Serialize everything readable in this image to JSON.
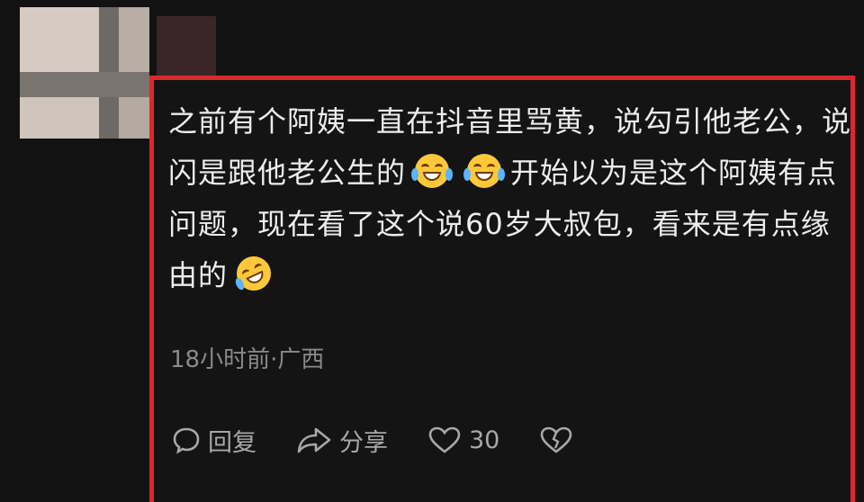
{
  "comment": {
    "text_part1": "之前有个阿姨一直在抖音里骂黄，说勾引他老公，说闪是跟他老公生的",
    "text_part2": "开始以为是这个阿姨有点问题，现在看了这个说60岁大叔包，看来是有点缘由的",
    "emoji_icons": [
      "laugh-cry-icon",
      "laugh-cry-icon",
      "rolling-laugh-icon"
    ],
    "meta": "18小时前·广西"
  },
  "actions": {
    "reply_label": "回复",
    "share_label": "分享",
    "like_count": "30"
  },
  "colors": {
    "highlight_border": "#e0262c",
    "background": "#121212",
    "text": "#ededed",
    "meta": "#8a8a8a"
  }
}
